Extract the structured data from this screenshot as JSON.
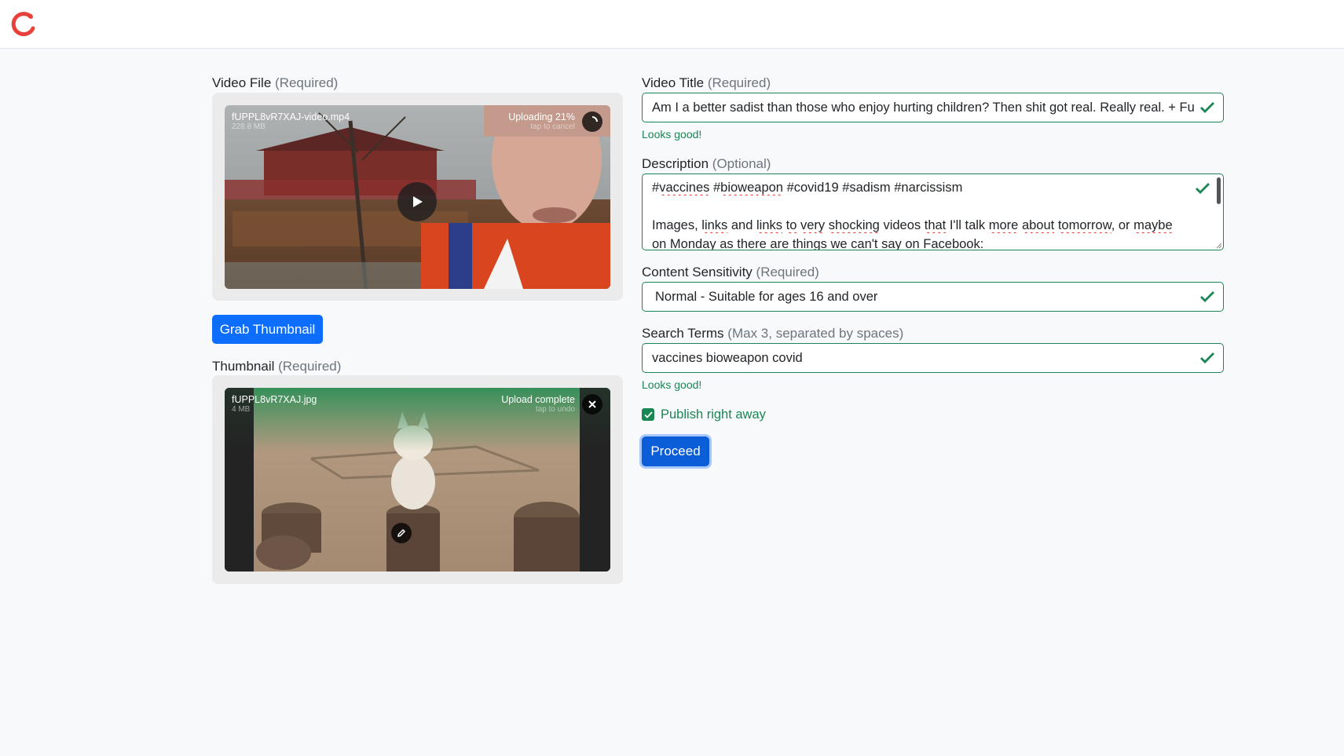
{
  "header": {
    "logo_icon": "refresh-c-logo-icon",
    "brand_color": "#e8403a"
  },
  "video_file": {
    "label": "Video File",
    "required": "(Required)",
    "filename": "fUPPL8vR7XAJ-video.mp4",
    "size": "228.8 MB",
    "status": "Uploading 21%",
    "sub_status": "tap to cancel",
    "progress": 0.21
  },
  "grab_button": "Grab Thumbnail",
  "thumbnail": {
    "label": "Thumbnail",
    "required": "(Required)",
    "filename": "fUPPL8vR7XAJ.jpg",
    "size": "4 MB",
    "status": "Upload complete",
    "sub_status": "tap to undo"
  },
  "title_field": {
    "label": "Video Title",
    "required": "(Required)",
    "value": "Am I a better sadist than those who enjoy hurting children? Then shit got real. Really real. + Fun",
    "feedback": "Looks good!"
  },
  "description_field": {
    "label": "Description",
    "optional": "(Optional)",
    "line1_words": [
      "#",
      "vaccines",
      " #",
      "bioweapon",
      " #covid19 #sadism #narcissism"
    ],
    "line2_words": [
      "Images, ",
      "links",
      " and ",
      "links",
      " ",
      "to",
      " ",
      "very",
      " ",
      "shocking",
      " videos ",
      "that",
      " I'll talk ",
      "more",
      " ",
      "about",
      " ",
      "tomorrow",
      ", or ",
      "maybe"
    ],
    "line3": "on Monday as there are things we can't say on Facebook:"
  },
  "sensitivity_field": {
    "label": "Content Sensitivity",
    "required": "(Required)",
    "value": "Normal - Suitable for ages 16 and over"
  },
  "search_field": {
    "label": "Search Terms",
    "hint": "(Max 3, separated by spaces)",
    "value": "vaccines bioweapon covid",
    "feedback": "Looks good!"
  },
  "publish": {
    "label": "Publish right away",
    "checked": true
  },
  "proceed_button": "Proceed",
  "colors": {
    "primary": "#0d6efd",
    "success": "#198754",
    "muted": "#6c757d"
  }
}
